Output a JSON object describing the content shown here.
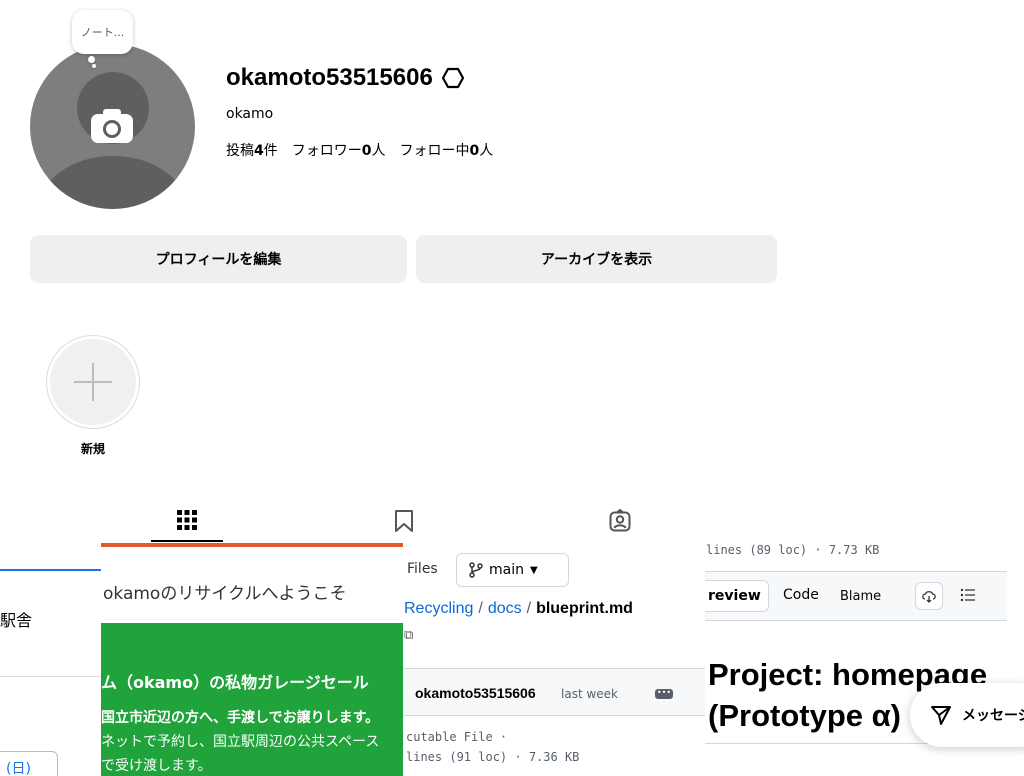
{
  "profile": {
    "note": "ノート...",
    "username": "okamoto53515606",
    "display_name": "okamo",
    "stats": {
      "posts_label": "投稿",
      "posts_count": "4",
      "posts_unit": "件",
      "followers_label": "フォロワー",
      "followers_count": "0",
      "followers_unit": "人",
      "following_label": "フォロー中",
      "following_count": "0",
      "following_unit": "人"
    }
  },
  "actions": {
    "edit_profile": "プロフィールを編集",
    "view_archive": "アーカイブを表示"
  },
  "highlights": {
    "new_label": "新規"
  },
  "posts": {
    "tile1": {
      "station": "駅舎",
      "day": "(日)"
    },
    "tile2": {
      "welcome": "okamoのリサイクルへようこそ",
      "line1": "ム（okamo）の私物ガレージセール",
      "line2": "国立市近辺の方へ、手渡しでお譲りします。",
      "line3": "ネットで予約し、国立駅周辺の公共スペース",
      "line4": "で受け渡します。"
    },
    "tile3": {
      "files": "Files",
      "branch": "main",
      "crumb_repo": "Recycling",
      "crumb_dir": "docs",
      "crumb_file": "blueprint.md",
      "author": "okamoto53515606",
      "when": "last week",
      "more": "•••",
      "exec": "cutable File ·",
      "lines": "lines (91 loc) · 7.36 KB"
    },
    "tile4": {
      "lines": "lines (89 loc) · 7.73 KB",
      "preview": "review",
      "code": "Code",
      "blame": "Blame",
      "heading1": "Project: homepage",
      "heading2": "(Prototype α)"
    }
  },
  "messages": {
    "label": "メッセージ"
  }
}
